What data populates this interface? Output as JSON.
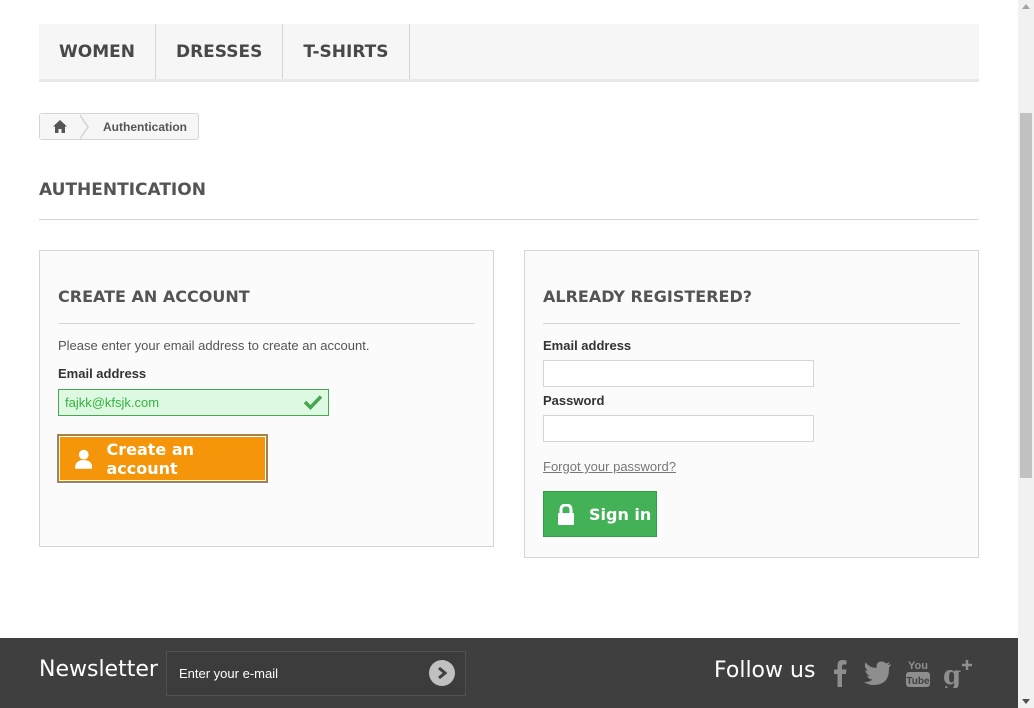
{
  "nav": {
    "items": [
      {
        "label": "WOMEN"
      },
      {
        "label": "DRESSES"
      },
      {
        "label": "T-SHIRTS"
      }
    ]
  },
  "breadcrumb": {
    "home_icon": "home-icon",
    "current": "Authentication"
  },
  "page": {
    "heading": "AUTHENTICATION"
  },
  "create_account": {
    "title": "CREATE AN ACCOUNT",
    "instructions": "Please enter your email address to create an account.",
    "email_label": "Email address",
    "email_value": "fajkk@kfsjk.com",
    "button_label": "Create an account",
    "button_icon": "user-icon",
    "valid_icon": "check-icon"
  },
  "login": {
    "title": "ALREADY REGISTERED?",
    "email_label": "Email address",
    "email_value": "",
    "password_label": "Password",
    "password_value": "",
    "forgot_label": "Forgot your password?",
    "button_label": "Sign in",
    "button_icon": "lock-icon"
  },
  "footer": {
    "newsletter_title": "Newsletter",
    "newsletter_placeholder": "Enter your e-mail",
    "follow_title": "Follow us",
    "social": [
      "facebook-icon",
      "twitter-icon",
      "youtube-icon",
      "google-plus-icon"
    ]
  },
  "colors": {
    "create_button": "#f5960a",
    "signin_button": "#43b155",
    "valid_field_bg": "#ddf9e1",
    "valid_text": "#35b33f",
    "footer_bg": "#3f3f3f"
  }
}
